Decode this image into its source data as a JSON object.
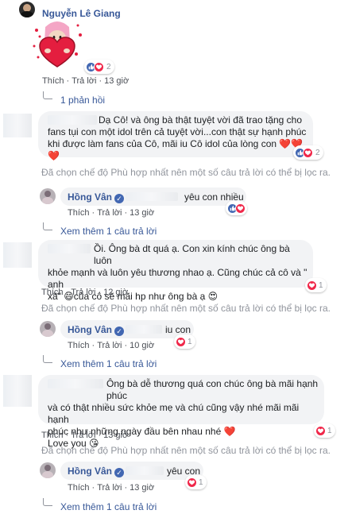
{
  "comment1": {
    "author": "Nguyễn Lê Giang",
    "reaction_count": "2",
    "like_label": "Thích",
    "reply_label": "Trả lời",
    "time": "13 giờ",
    "replies_toggle": "1 phản hồi"
  },
  "comment2": {
    "text": "Dạ Cô! và ông bà thật tuyệt vời đã trao tặng cho fans tụi con một idol trên cả tuyệt vời...con thật sự hạnh phúc khi được làm fans của Cô, mãi iu Cô idol của lòng con",
    "emoji": "❤️❤️❤️",
    "reaction_count": "2",
    "notice": "Đã chọn chế độ Phù hợp nhất nên một số câu trả lời có thể bị lọc ra.",
    "reply": {
      "author": "Hồng Vân",
      "text": "yêu con nhiều",
      "like_label": "Thích",
      "reply_label": "Trả lời",
      "time": "13 giờ"
    },
    "see_more": "Xem thêm 1 câu trả lời"
  },
  "comment3": {
    "text_line1": "Ồi. Ông bà dt quá ạ. Con xin kính chúc ông bà luôn",
    "text_line2": "khỏe mạnh và luôn yêu thương nhao ạ. Cũng chúc cả cô và \" anh",
    "text_line3": "xã\" 😄của cô sẽ mãi hp như ông bà ạ 😍",
    "reaction_count": "1",
    "like_label": "Thích",
    "reply_label": "Trả lời",
    "time": "12 giờ",
    "notice": "Đã chọn chế độ Phù hợp nhất nên một số câu trả lời có thể bị lọc ra.",
    "reply": {
      "author": "Hồng Vân",
      "text": "iu con",
      "reaction_count": "1",
      "like_label": "Thích",
      "reply_label": "Trả lời",
      "time": "10 giờ"
    },
    "see_more": "Xem thêm 1 câu trả lời"
  },
  "comment4": {
    "text_line1": "Ông bà dễ thương quá con chúc ông bà mãi hạnh phúc",
    "text_line2": "và có thật nhiều sức khỏe mẹ và chú cũng vậy nhé mãi mãi hạnh",
    "text_line3": "phúc như những ngày đầu bên nhau nhé ❤️",
    "text_line4": "Love you 😘",
    "reaction_count": "1",
    "like_label": "Thích",
    "reply_label": "Trả lời",
    "time": "13 giờ",
    "notice": "Đã chọn chế độ Phù hợp nhất nên một số câu trả lời có thể bị lọc ra.",
    "reply": {
      "author": "Hồng Vân",
      "text": "yêu con",
      "reaction_count": "1",
      "like_label": "Thích",
      "reply_label": "Trả lời",
      "time": "13 giờ"
    },
    "see_more": "Xem thêm 1 câu trả lời"
  },
  "colors": {
    "link": "#385898",
    "muted": "#90949c",
    "bubble": "#f2f3f5",
    "love": "#f0284a",
    "like": "#4267b2"
  }
}
